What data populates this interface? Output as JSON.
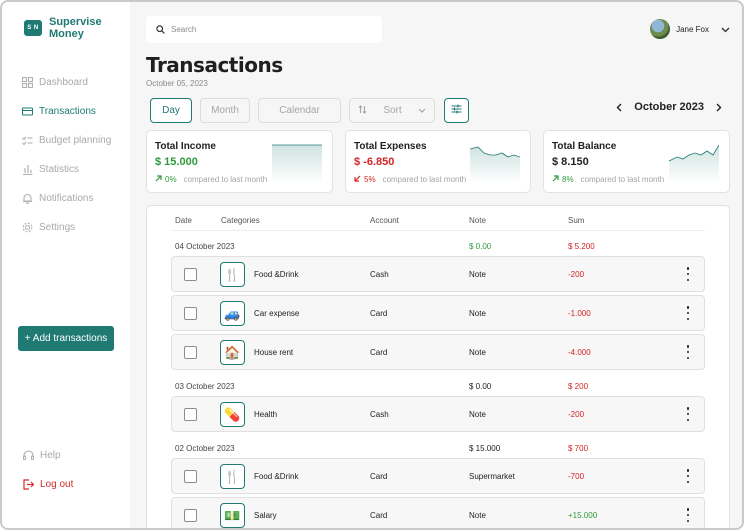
{
  "brand": {
    "name": "Supervise Money",
    "mark": "S N"
  },
  "sidebar": {
    "items": [
      {
        "label": "Dashboard",
        "icon": "grid-icon"
      },
      {
        "label": "Transactions",
        "icon": "card-icon",
        "active": true
      },
      {
        "label": "Budget planning",
        "icon": "checklist-icon"
      },
      {
        "label": "Statistics",
        "icon": "bar-chart-icon"
      },
      {
        "label": "Notifications",
        "icon": "bell-icon"
      },
      {
        "label": "Settings",
        "icon": "gear-icon"
      }
    ],
    "add_button": "+ Add transactions",
    "help": "Help",
    "logout": "Log out"
  },
  "search": {
    "placeholder": "Search"
  },
  "user": {
    "name": "Jane Fox"
  },
  "page": {
    "title": "Transactions",
    "date": "October 05, 2023"
  },
  "view_buttons": {
    "day": "Day",
    "month": "Month",
    "calendar": "Calendar",
    "sort": "Sort"
  },
  "month_nav": {
    "label": "October 2023"
  },
  "summary": [
    {
      "title": "Total Income",
      "value": "$ 15.000",
      "pct": "0%",
      "compare": "compared to last month",
      "color": "#2e9a3c"
    },
    {
      "title": "Total Expenses",
      "value": "$ -6.850",
      "pct": "5%",
      "compare": "compared to last month",
      "color": "#d42323"
    },
    {
      "title": "Total Balance",
      "value": "$ 8.150",
      "pct": "8%",
      "compare": "compared to last month",
      "color": "#222222"
    }
  ],
  "table": {
    "headers": {
      "date": "Date",
      "categories": "Categories",
      "account": "Account",
      "note": "Note",
      "sum": "Sum"
    },
    "groups": [
      {
        "date": "04 October 2023",
        "income": "$ 0.00",
        "expense": "$ 5.200",
        "income_green": true,
        "rows": [
          {
            "category": "Food &Drink",
            "icon": "🍴",
            "account": "Cash",
            "note": "Note",
            "sum": "-200"
          },
          {
            "category": "Car expense",
            "icon": "🚙",
            "account": "Card",
            "note": "Note",
            "sum": "-1.000"
          },
          {
            "category": "House rent",
            "icon": "🏠",
            "account": "Card",
            "note": "Note",
            "sum": "-4.000"
          }
        ]
      },
      {
        "date": "03 October 2023",
        "income": "$ 0.00",
        "expense": "$ 200",
        "income_green": false,
        "rows": [
          {
            "category": "Health",
            "icon": "💊",
            "account": "Cash",
            "note": "Note",
            "sum": "-200"
          }
        ]
      },
      {
        "date": "02 October 2023",
        "income": "$ 15.000",
        "expense": "$ 700",
        "income_green": false,
        "rows": [
          {
            "category": "Food &Drink",
            "icon": "🍴",
            "account": "Card",
            "note": "Supermarket",
            "sum": "-700"
          },
          {
            "category": "Salary",
            "icon": "💵",
            "account": "Card",
            "note": "Note",
            "sum": "+15.000"
          }
        ]
      }
    ]
  }
}
